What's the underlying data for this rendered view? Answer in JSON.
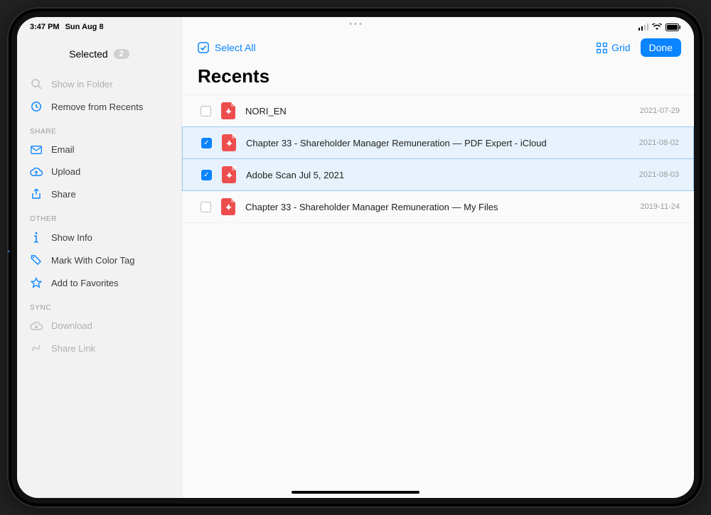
{
  "status": {
    "time": "3:47 PM",
    "date": "Sun Aug 8"
  },
  "sidebar": {
    "selected_label": "Selected",
    "selected_count": "2",
    "top": [
      {
        "icon": "search",
        "label": "Show in Folder",
        "disabled": true
      },
      {
        "icon": "clock",
        "label": "Remove from Recents",
        "disabled": false
      }
    ],
    "sections": [
      {
        "title": "SHARE",
        "items": [
          {
            "icon": "mail",
            "label": "Email"
          },
          {
            "icon": "cloud",
            "label": "Upload"
          },
          {
            "icon": "share",
            "label": "Share"
          }
        ]
      },
      {
        "title": "OTHER",
        "items": [
          {
            "icon": "info",
            "label": "Show Info"
          },
          {
            "icon": "tag",
            "label": "Mark With Color Tag"
          },
          {
            "icon": "star",
            "label": "Add to Favorites"
          }
        ]
      },
      {
        "title": "SYNC",
        "items": [
          {
            "icon": "download",
            "label": "Download",
            "disabled": true
          },
          {
            "icon": "link",
            "label": "Share Link",
            "disabled": true
          }
        ]
      }
    ]
  },
  "toolbar": {
    "select_all": "Select All",
    "grid": "Grid",
    "done": "Done"
  },
  "page_title": "Recents",
  "files": [
    {
      "name": "NORI_EN",
      "date": "2021-07-29",
      "selected": false
    },
    {
      "name": "Chapter 33 - Shareholder Manager Remuneration — PDF Expert - iCloud",
      "date": "2021-08-02",
      "selected": true
    },
    {
      "name": "Adobe Scan Jul 5, 2021",
      "date": "2021-08-03",
      "selected": true
    },
    {
      "name": "Chapter 33 - Shareholder Manager Remuneration — My Files",
      "date": "2019-11-24",
      "selected": false
    }
  ]
}
